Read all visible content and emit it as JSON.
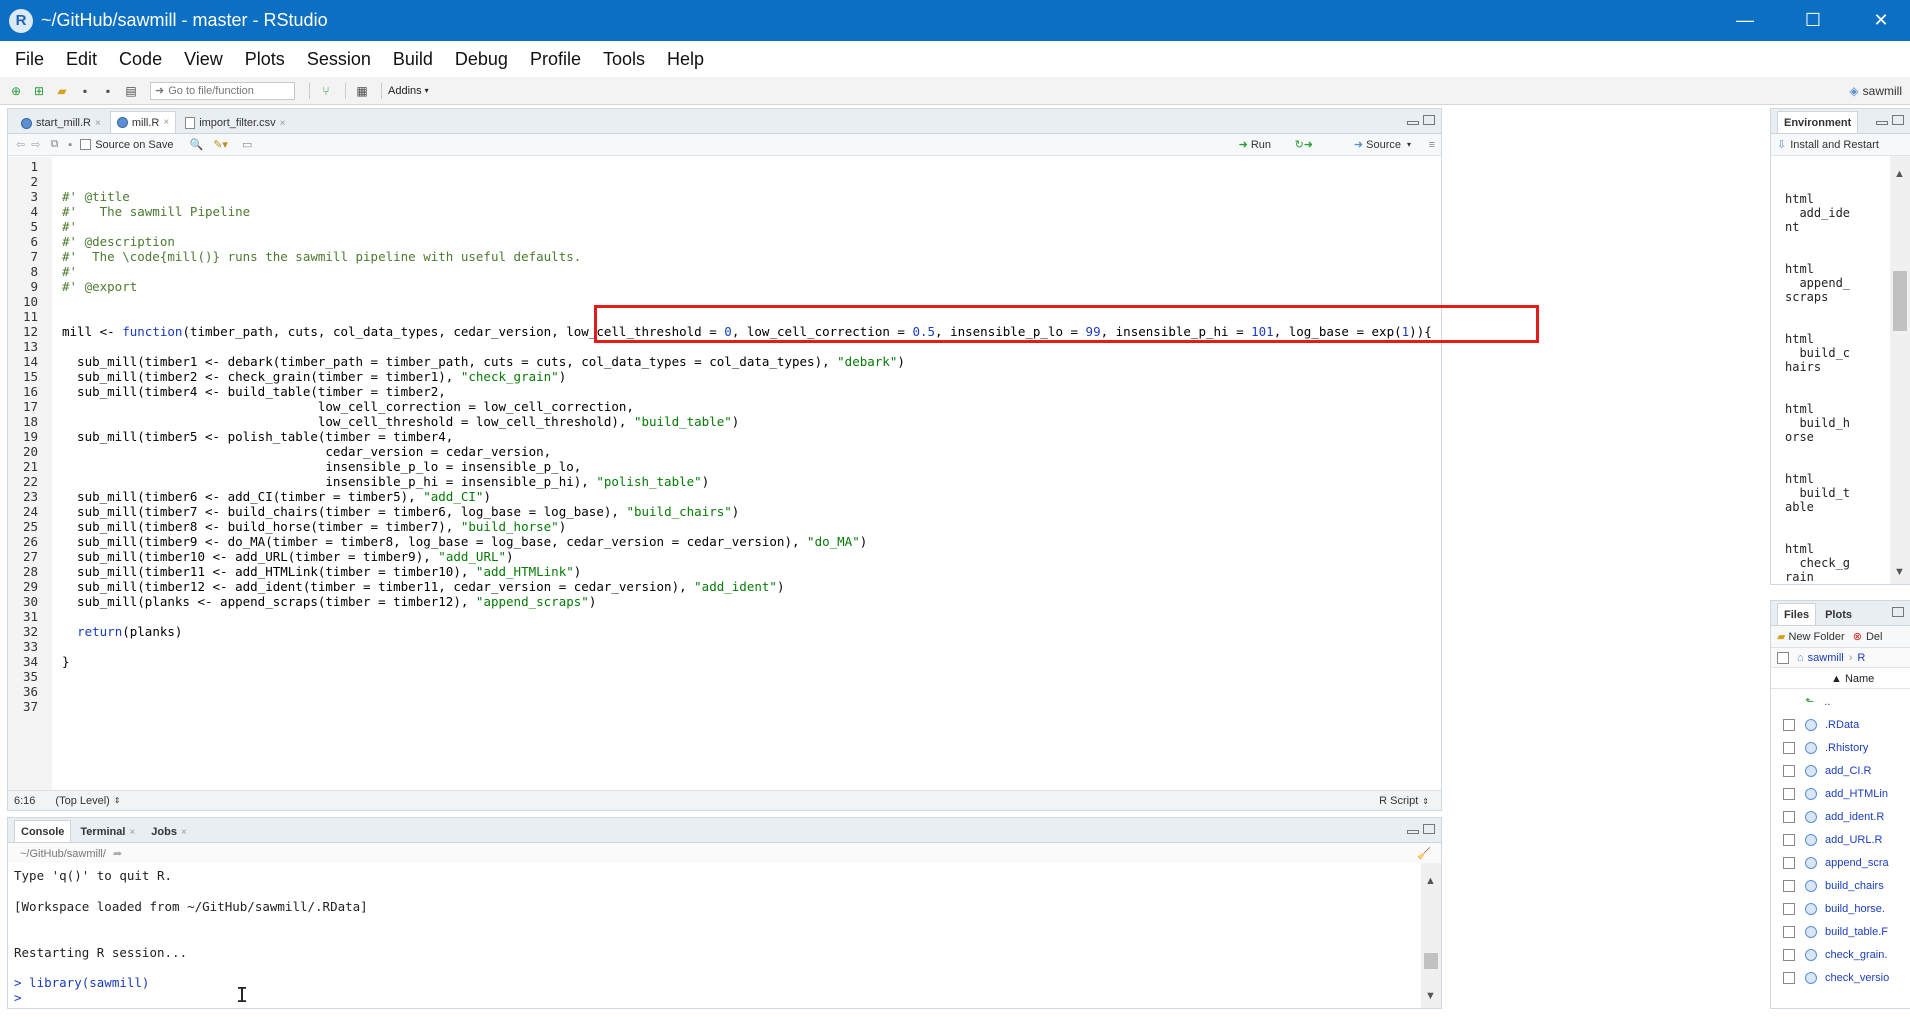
{
  "window": {
    "title": "~/GitHub/sawmill - master - RStudio",
    "logo": "R",
    "minimize": "—",
    "maximize": "☐",
    "close": "✕"
  },
  "menu": [
    "File",
    "Edit",
    "Code",
    "View",
    "Plots",
    "Session",
    "Build",
    "Debug",
    "Profile",
    "Tools",
    "Help"
  ],
  "toolbar": {
    "goto_placeholder": "Go to file/function",
    "addins": "Addins",
    "project": "sawmill"
  },
  "editor": {
    "tabs": [
      {
        "label": "start_mill.R",
        "close": "×"
      },
      {
        "label": "mill.R",
        "close": "×"
      },
      {
        "label": "import_filter.csv",
        "close": "×"
      }
    ],
    "source_on_save": "Source on Save",
    "run": "Run",
    "source": "Source",
    "status_pos": "6:16",
    "status_scope": "(Top Level)",
    "status_type": "R Script"
  },
  "code_lines": [
    {
      "n": "1",
      "html": ""
    },
    {
      "n": "2",
      "html": ""
    },
    {
      "n": "3",
      "html": "<span class='cm'>#' @title</span>"
    },
    {
      "n": "4",
      "html": "<span class='cm'>#'   The sawmill Pipeline</span>"
    },
    {
      "n": "5",
      "html": "<span class='cm'>#'</span>"
    },
    {
      "n": "6",
      "html": "<span class='cm'>#' @description</span>"
    },
    {
      "n": "7",
      "html": "<span class='cm'>#'  The \\code{mill()} runs the sawmill pipeline with useful defaults.</span>"
    },
    {
      "n": "8",
      "html": "<span class='cm'>#'</span>"
    },
    {
      "n": "9",
      "html": "<span class='cm'>#' @export</span>"
    },
    {
      "n": "10",
      "html": ""
    },
    {
      "n": "11",
      "html": ""
    },
    {
      "n": "12",
      "html": "mill <- <span class='kw'>function</span>(timber_path, cuts, col_data_types, cedar_version, low_cell_threshold = <span class='num'>0</span>, low_cell_correction = <span class='num'>0.5</span>, insensible_p_lo = <span class='num'>99</span>, insensible_p_hi = <span class='num'>101</span>, log_base = exp(<span class='num'>1</span>)){"
    },
    {
      "n": "13",
      "html": ""
    },
    {
      "n": "14",
      "html": "  sub_mill(timber1 <- debark(timber_path = timber_path, cuts = cuts, col_data_types = col_data_types), <span class='str'>\"debark\"</span>)"
    },
    {
      "n": "15",
      "html": "  sub_mill(timber2 <- check_grain(timber = timber1), <span class='str'>\"check_grain\"</span>)"
    },
    {
      "n": "16",
      "html": "  sub_mill(timber4 <- build_table(timber = timber2,"
    },
    {
      "n": "17",
      "html": "                                  low_cell_correction = low_cell_correction,"
    },
    {
      "n": "18",
      "html": "                                  low_cell_threshold = low_cell_threshold), <span class='str'>\"build_table\"</span>)"
    },
    {
      "n": "19",
      "html": "  sub_mill(timber5 <- polish_table(timber = timber4,"
    },
    {
      "n": "20",
      "html": "                                   cedar_version = cedar_version,"
    },
    {
      "n": "21",
      "html": "                                   insensible_p_lo = insensible_p_lo,"
    },
    {
      "n": "22",
      "html": "                                   insensible_p_hi = insensible_p_hi), <span class='str'>\"polish_table\"</span>)"
    },
    {
      "n": "23",
      "html": "  sub_mill(timber6 <- add_CI(timber = timber5), <span class='str'>\"add_CI\"</span>)"
    },
    {
      "n": "24",
      "html": "  sub_mill(timber7 <- build_chairs(timber = timber6, log_base = log_base), <span class='str'>\"build_chairs\"</span>)"
    },
    {
      "n": "25",
      "html": "  sub_mill(timber8 <- build_horse(timber = timber7), <span class='str'>\"build_horse\"</span>)"
    },
    {
      "n": "26",
      "html": "  sub_mill(timber9 <- do_MA(timber = timber8, log_base = log_base, cedar_version = cedar_version), <span class='str'>\"do_MA\"</span>)"
    },
    {
      "n": "27",
      "html": "  sub_mill(timber10 <- add_URL(timber = timber9), <span class='str'>\"add_URL\"</span>)"
    },
    {
      "n": "28",
      "html": "  sub_mill(timber11 <- add_HTMLink(timber = timber10), <span class='str'>\"add_HTMLink\"</span>)"
    },
    {
      "n": "29",
      "html": "  sub_mill(timber12 <- add_ident(timber = timber11, cedar_version = cedar_version), <span class='str'>\"add_ident\"</span>)"
    },
    {
      "n": "30",
      "html": "  sub_mill(planks <- append_scraps(timber = timber12), <span class='str'>\"append_scraps\"</span>)"
    },
    {
      "n": "31",
      "html": ""
    },
    {
      "n": "32",
      "html": "  <span class='kw'>return</span>(planks)"
    },
    {
      "n": "33",
      "html": ""
    },
    {
      "n": "34",
      "html": "}"
    },
    {
      "n": "35",
      "html": ""
    },
    {
      "n": "36",
      "html": ""
    },
    {
      "n": "37",
      "html": ""
    }
  ],
  "console": {
    "tabs": [
      {
        "label": "Console",
        "close": ""
      },
      {
        "label": "Terminal",
        "close": "×"
      },
      {
        "label": "Jobs",
        "close": "×"
      }
    ],
    "path": "~/GitHub/sawmill/",
    "lines": [
      {
        "html": "Type 'q()' to quit R."
      },
      {
        "html": ""
      },
      {
        "html": "[Workspace loaded from ~/GitHub/sawmill/.RData]"
      },
      {
        "html": ""
      },
      {
        "html": ""
      },
      {
        "html": "Restarting R session..."
      },
      {
        "html": ""
      },
      {
        "html": "<span class='prompt'>&gt; library(sawmill)</span>"
      },
      {
        "html": "<span class='prompt'>&gt;</span>"
      }
    ]
  },
  "environment": {
    "tab": "Environment",
    "install": "Install and Restart",
    "items": [
      "html\n  add_ide\nnt",
      "html\n  append_\nscraps",
      "html\n  build_c\nhairs",
      "html\n  build_h\norse",
      "html\n  build_t\nable",
      "html\n  check_g\nrain"
    ]
  },
  "files": {
    "tabs": [
      "Files",
      "Plots"
    ],
    "new_folder": "New Folder",
    "delete": "Del",
    "crumbs": [
      "sawmill",
      "R"
    ],
    "name_header": "▲ Name",
    "up": "..",
    "rows": [
      ".RData",
      ".Rhistory",
      "add_CI.R",
      "add_HTMLin",
      "add_ident.R",
      "add_URL.R",
      "append_scra",
      "build_chairs",
      "build_horse.",
      "build_table.F",
      "check_grain.",
      "check_versio"
    ]
  }
}
